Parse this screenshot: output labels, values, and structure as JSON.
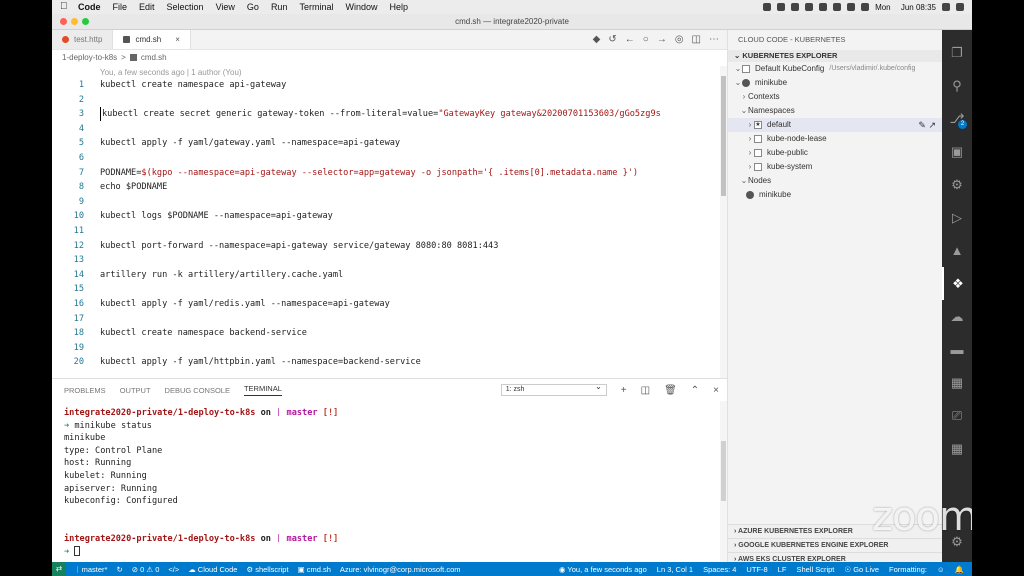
{
  "menubar": {
    "app": "Code",
    "items": [
      "File",
      "Edit",
      "Selection",
      "View",
      "Go",
      "Run",
      "Terminal",
      "Window",
      "Help"
    ],
    "clock": "Mon  Jun 08:35"
  },
  "window": {
    "title": "cmd.sh — integrate2020-private"
  },
  "tabs": [
    {
      "label": "test.http",
      "active": false
    },
    {
      "label": "cmd.sh",
      "active": true,
      "close": "×"
    }
  ],
  "breadcrumb": {
    "folder": "1-deploy-to-k8s",
    "sep": ">",
    "file": "cmd.sh"
  },
  "blame": "You, a few seconds ago | 1 author (You)",
  "code_lines": [
    {
      "n": "1",
      "t": "kubectl create namespace api-gateway"
    },
    {
      "n": "2",
      "t": ""
    },
    {
      "n": "3",
      "t": "kubectl create secret generic gateway-token --from-literal=value=",
      "s": "\"GatewayKey gateway&20200701153603/gGo5zg9s"
    },
    {
      "n": "4",
      "t": ""
    },
    {
      "n": "5",
      "t": "kubectl apply -f yaml/gateway.yaml --namespace=api-gateway"
    },
    {
      "n": "6",
      "t": ""
    },
    {
      "n": "7",
      "t": "PODNAME=",
      "s": "$(kgpo --namespace=api-gateway --selector=app=gateway -o jsonpath='{ .items[0].metadata.name }')"
    },
    {
      "n": "8",
      "t": "echo $PODNAME"
    },
    {
      "n": "9",
      "t": ""
    },
    {
      "n": "10",
      "t": "kubectl logs $PODNAME --namespace=api-gateway"
    },
    {
      "n": "11",
      "t": ""
    },
    {
      "n": "12",
      "t": "kubectl port-forward --namespace=api-gateway service/gateway 8080:80 8081:443"
    },
    {
      "n": "13",
      "t": ""
    },
    {
      "n": "14",
      "t": "artillery run -k artillery/artillery.cache.yaml"
    },
    {
      "n": "15",
      "t": ""
    },
    {
      "n": "16",
      "t": "kubectl apply -f yaml/redis.yaml --namespace=api-gateway"
    },
    {
      "n": "17",
      "t": ""
    },
    {
      "n": "18",
      "t": "kubectl create namespace backend-service"
    },
    {
      "n": "19",
      "t": ""
    },
    {
      "n": "20",
      "t": "kubectl apply -f yaml/httpbin.yaml --namespace=backend-service"
    }
  ],
  "explorer": {
    "title": "CLOUD CODE - KUBERNETES",
    "section": "KUBERNETES EXPLORER",
    "kubeconfig": "Default KubeConfig",
    "kubeconfig_path": "/Users/vladimir/.kube/config",
    "cluster": "minikube",
    "contexts": "Contexts",
    "namespaces": "Namespaces",
    "ns_items": [
      "default",
      "kube-node-lease",
      "kube-public",
      "kube-system"
    ],
    "nodes": "Nodes",
    "node": "minikube",
    "bottom_sections": [
      "AZURE KUBERNETES EXPLORER",
      "GOOGLE KUBERNETES ENGINE EXPLORER",
      "AWS EKS CLUSTER EXPLORER"
    ]
  },
  "panel": {
    "tabs": [
      "PROBLEMS",
      "OUTPUT",
      "DEBUG CONSOLE",
      "TERMINAL"
    ],
    "active_tab": "TERMINAL",
    "terminal_select": "1: zsh"
  },
  "terminal": {
    "prompt_path": "integrate2020-private/1-deploy-to-k8s",
    "prompt_on": "on",
    "branch": "master",
    "flag": "[!]",
    "command": "minikube status",
    "output": [
      "minikube",
      "type: Control Plane",
      "host: Running",
      "kubelet: Running",
      "apiserver: Running",
      "kubeconfig: Configured"
    ]
  },
  "statusbar": {
    "branch": "master*",
    "sync": "",
    "errors": "0",
    "warnings": "0",
    "cloud": "Cloud Code",
    "shellscript": "shellscript",
    "file": "cmd.sh",
    "azure": "Azure: vlvinogr@corp.microsoft.com",
    "blame": "You, a few seconds ago",
    "position": "Ln 3, Col 1",
    "spaces": "Spaces: 4",
    "encoding": "UTF-8",
    "eol": "LF",
    "lang": "Shell Script",
    "golive": "Go Live",
    "formatting": "Formatting:"
  },
  "watermark": "zoom",
  "colors": {
    "statusbar": "#007acc",
    "activity": "#2c2c2c",
    "string": "#a31515",
    "linenum": "#237893"
  }
}
